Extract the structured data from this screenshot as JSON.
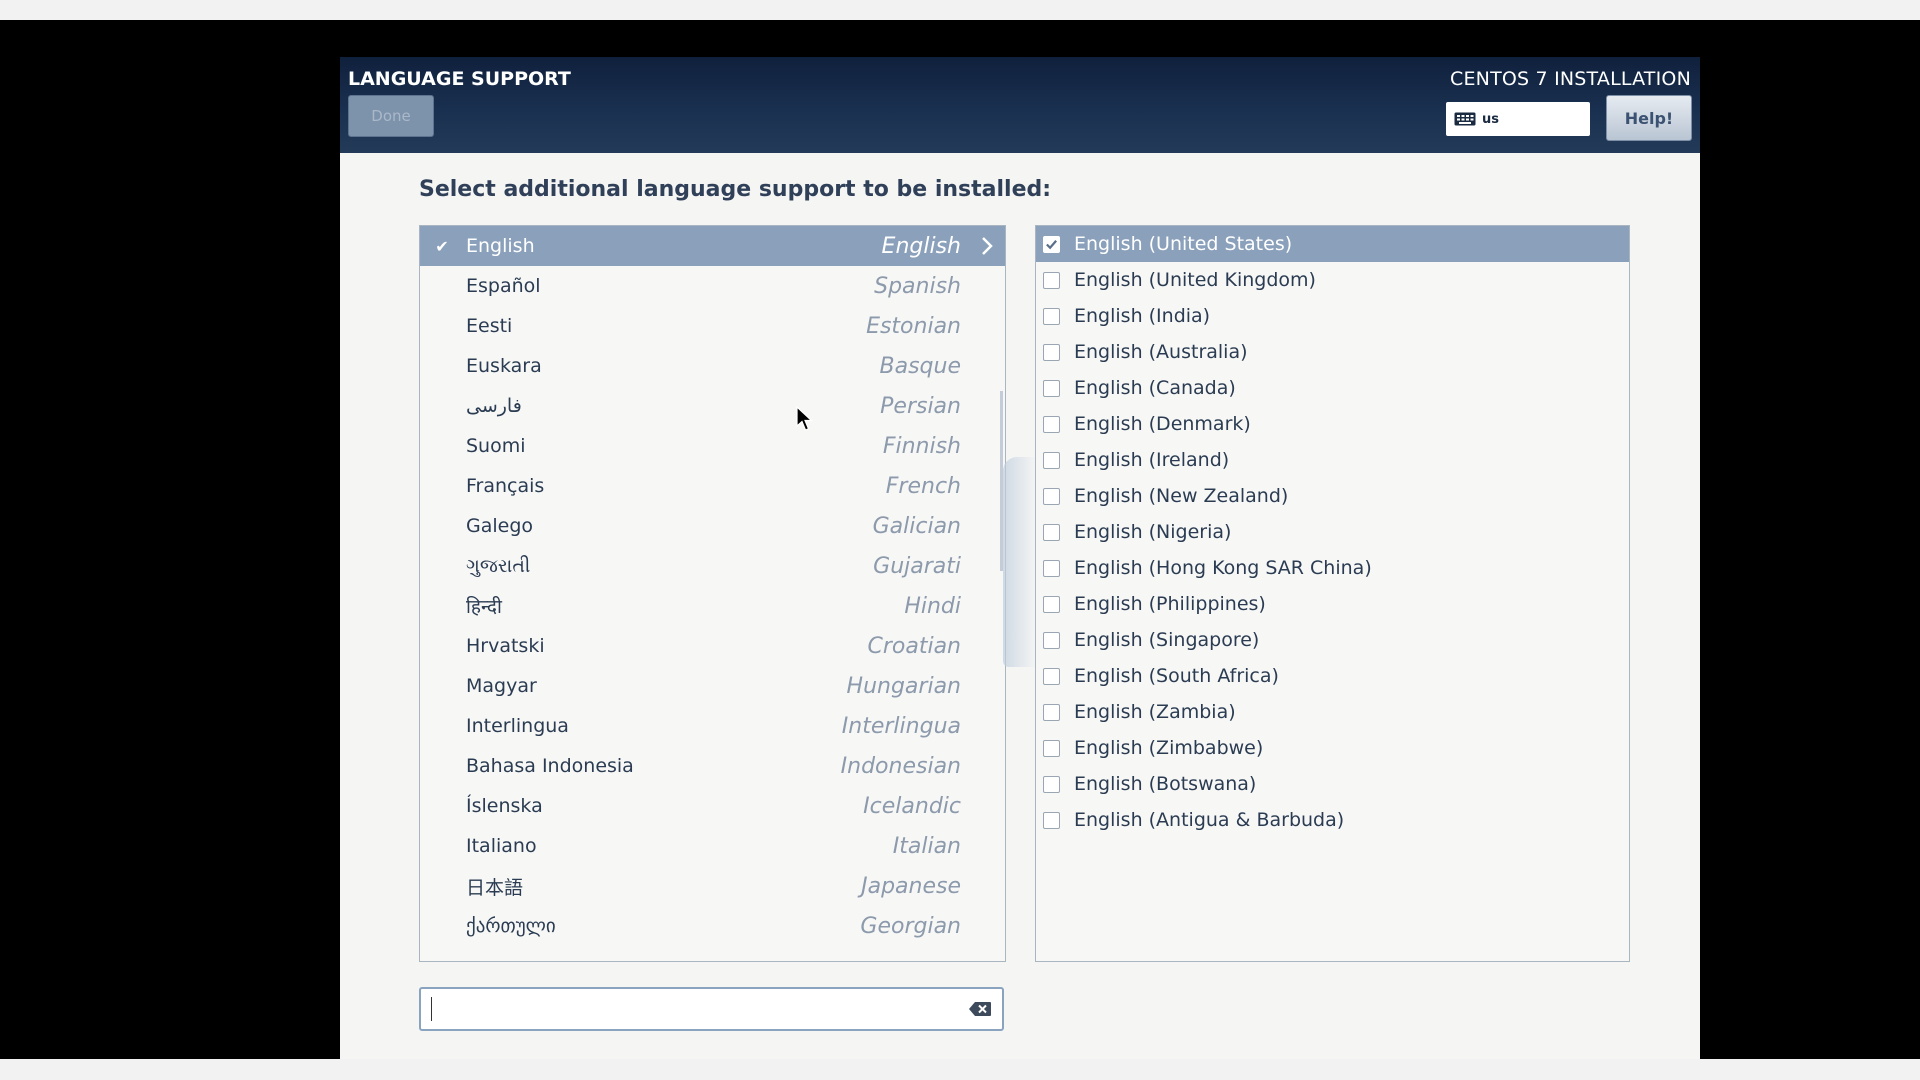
{
  "header": {
    "spoke_title": "LANGUAGE SUPPORT",
    "done_label": "Done",
    "product_title": "CENTOS 7 INSTALLATION",
    "keyboard_layout": "us",
    "help_label": "Help!"
  },
  "main": {
    "prompt": "Select additional language support to be installed:"
  },
  "languages": [
    {
      "native": "English",
      "english": "English",
      "selected": true
    },
    {
      "native": "Español",
      "english": "Spanish"
    },
    {
      "native": "Eesti",
      "english": "Estonian"
    },
    {
      "native": "Euskara",
      "english": "Basque"
    },
    {
      "native": "فارسی",
      "english": "Persian"
    },
    {
      "native": "Suomi",
      "english": "Finnish"
    },
    {
      "native": "Français",
      "english": "French"
    },
    {
      "native": "Galego",
      "english": "Galician"
    },
    {
      "native": "ગુજરાતી",
      "english": "Gujarati"
    },
    {
      "native": "हिन्दी",
      "english": "Hindi"
    },
    {
      "native": "Hrvatski",
      "english": "Croatian"
    },
    {
      "native": "Magyar",
      "english": "Hungarian"
    },
    {
      "native": "Interlingua",
      "english": "Interlingua"
    },
    {
      "native": "Bahasa Indonesia",
      "english": "Indonesian"
    },
    {
      "native": "Íslenska",
      "english": "Icelandic"
    },
    {
      "native": "Italiano",
      "english": "Italian"
    },
    {
      "native": "日本語",
      "english": "Japanese"
    },
    {
      "native": "ქართული",
      "english": "Georgian"
    }
  ],
  "locales": [
    {
      "label": "English (United States)",
      "checked": true,
      "selected": true
    },
    {
      "label": "English (United Kingdom)",
      "checked": false
    },
    {
      "label": "English (India)",
      "checked": false
    },
    {
      "label": "English (Australia)",
      "checked": false
    },
    {
      "label": "English (Canada)",
      "checked": false
    },
    {
      "label": "English (Denmark)",
      "checked": false
    },
    {
      "label": "English (Ireland)",
      "checked": false
    },
    {
      "label": "English (New Zealand)",
      "checked": false
    },
    {
      "label": "English (Nigeria)",
      "checked": false
    },
    {
      "label": "English (Hong Kong SAR China)",
      "checked": false
    },
    {
      "label": "English (Philippines)",
      "checked": false
    },
    {
      "label": "English (Singapore)",
      "checked": false
    },
    {
      "label": "English (South Africa)",
      "checked": false
    },
    {
      "label": "English (Zambia)",
      "checked": false
    },
    {
      "label": "English (Zimbabwe)",
      "checked": false
    },
    {
      "label": "English (Botswana)",
      "checked": false
    },
    {
      "label": "English (Antigua & Barbuda)",
      "checked": false
    }
  ],
  "search": {
    "value": "",
    "placeholder": ""
  },
  "icons": {
    "check": "checkmark-icon",
    "arrow": "chevron-right-icon",
    "keyboard": "keyboard-icon",
    "clear": "clear-text-icon"
  },
  "colors": {
    "header_bg": "#1a3050",
    "selection": "#8aa0bb",
    "panel_bg": "#f5f5f4",
    "text": "#2b3c52"
  }
}
